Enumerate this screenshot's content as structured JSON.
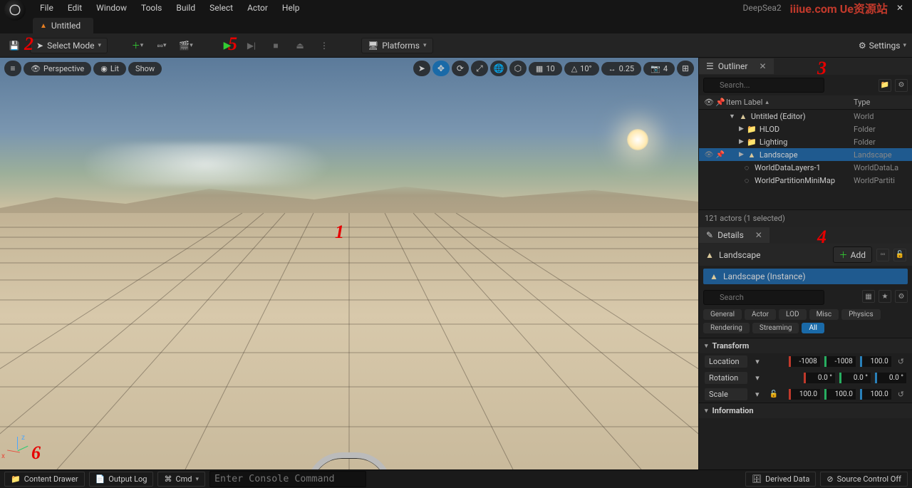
{
  "project_name": "DeepSea2",
  "watermark": "iiiue.com  Ue资源站",
  "menu": {
    "items": [
      "File",
      "Edit",
      "Window",
      "Tools",
      "Build",
      "Select",
      "Actor",
      "Help"
    ]
  },
  "level_tab": "Untitled",
  "toolbar": {
    "save": "Save",
    "select_mode": "Select Mode",
    "platforms": "Platforms",
    "settings": "Settings"
  },
  "viewport": {
    "menu": "≡",
    "perspective": "Perspective",
    "lit": "Lit",
    "show": "Show",
    "grid_size": "10",
    "angle": "10°",
    "scale": "0.25",
    "camera": "4"
  },
  "annotations": {
    "a1": "1",
    "a2": "2",
    "a3": "3",
    "a4": "4",
    "a5": "5",
    "a6": "6"
  },
  "outliner": {
    "title": "Outliner",
    "search_ph": "Search...",
    "col_label": "Item Label",
    "col_type": "Type",
    "rows": [
      {
        "indent": 0,
        "icon": "world",
        "label": "Untitled (Editor)",
        "type": "World",
        "vis": "",
        "pin": "",
        "sel": false,
        "expander": "▼"
      },
      {
        "indent": 1,
        "icon": "folder",
        "label": "HLOD",
        "type": "Folder",
        "vis": "",
        "pin": "",
        "sel": false,
        "expander": "▶"
      },
      {
        "indent": 1,
        "icon": "folder",
        "label": "Lighting",
        "type": "Folder",
        "vis": "",
        "pin": "",
        "sel": false,
        "expander": "▶"
      },
      {
        "indent": 1,
        "icon": "land",
        "label": "Landscape",
        "type": "Landscape",
        "vis": "👁",
        "pin": "📌",
        "sel": true,
        "expander": "▶"
      },
      {
        "indent": 1,
        "icon": "data",
        "label": "WorldDataLayers-1",
        "type": "WorldDataLa",
        "vis": "",
        "pin": "",
        "sel": false,
        "expander": ""
      },
      {
        "indent": 1,
        "icon": "data",
        "label": "WorldPartitionMiniMap",
        "type": "WorldPartiti",
        "vis": "",
        "pin": "",
        "sel": false,
        "expander": ""
      }
    ],
    "status": "121 actors (1 selected)"
  },
  "details": {
    "title": "Details",
    "object": "Landscape",
    "add": "Add",
    "instance": "Landscape (Instance)",
    "search_ph": "Search",
    "filters": [
      {
        "label": "General",
        "on": false
      },
      {
        "label": "Actor",
        "on": false
      },
      {
        "label": "LOD",
        "on": false
      },
      {
        "label": "Misc",
        "on": false
      },
      {
        "label": "Physics",
        "on": false
      },
      {
        "label": "Rendering",
        "on": false
      },
      {
        "label": "Streaming",
        "on": false
      },
      {
        "label": "All",
        "on": true
      }
    ],
    "transform": {
      "title": "Transform",
      "location": {
        "label": "Location",
        "x": "-1008",
        "y": "-1008",
        "z": "100.0"
      },
      "rotation": {
        "label": "Rotation",
        "x": "0.0 °",
        "y": "0.0 °",
        "z": "0.0 °"
      },
      "scale": {
        "label": "Scale",
        "x": "100.0",
        "y": "100.0",
        "z": "100.0"
      }
    },
    "information_title": "Information"
  },
  "bottom": {
    "content_drawer": "Content Drawer",
    "output_log": "Output Log",
    "cmd": "Cmd",
    "console_ph": "Enter Console Command",
    "derived": "Derived Data",
    "source": "Source Control Off"
  }
}
